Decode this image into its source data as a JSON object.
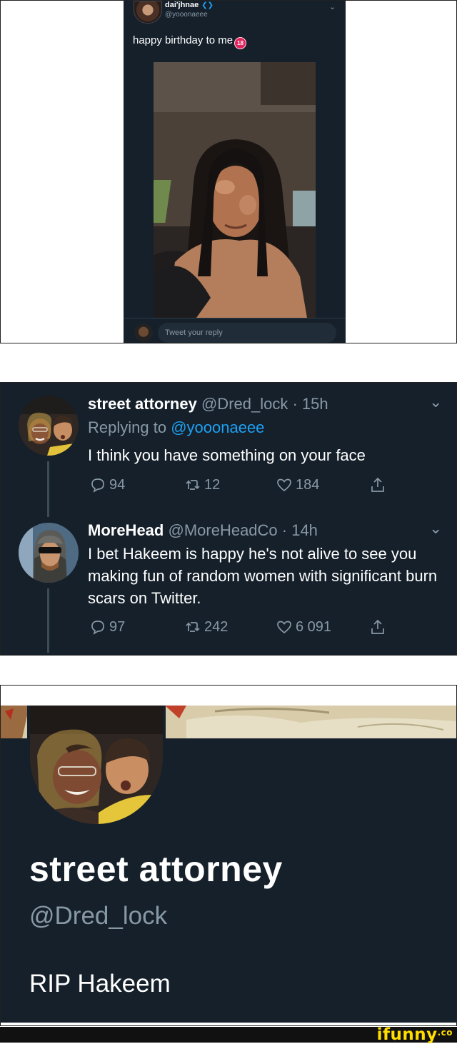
{
  "colors": {
    "background_dark": "#15202b",
    "text_secondary": "#8899a6",
    "link_blue": "#1da1f2",
    "footer_bg": "#111111",
    "watermark_yellow": "#ffdd00"
  },
  "original_tweet": {
    "display_name": "dai'jhnae",
    "handle": "@yooonaeee",
    "badge_icon": "butterfly-icon",
    "text": "happy birthday to me",
    "emoji_label": "18",
    "reply_placeholder": "Tweet your reply"
  },
  "replies": [
    {
      "display_name": "street attorney",
      "handle_time": "@Dred_lock · 15h",
      "replying_prefix": "Replying to",
      "replying_to": "@yooonaeee",
      "text": "I think you have something on your face",
      "counts": {
        "replies": "94",
        "retweets": "12",
        "likes": "184"
      }
    },
    {
      "display_name": "MoreHead",
      "handle_time": "@MoreHeadCo · 14h",
      "text": "I bet Hakeem is happy he's not alive to see you making fun of random women with significant burn scars on Twitter.",
      "counts": {
        "replies": "97",
        "retweets": "242",
        "likes": "6 091"
      }
    }
  ],
  "profile": {
    "display_name": "street attorney",
    "handle": "@Dred_lock",
    "bio": "RIP Hakeem"
  },
  "watermark": {
    "text": "ifunny",
    "suffix": ".co"
  }
}
